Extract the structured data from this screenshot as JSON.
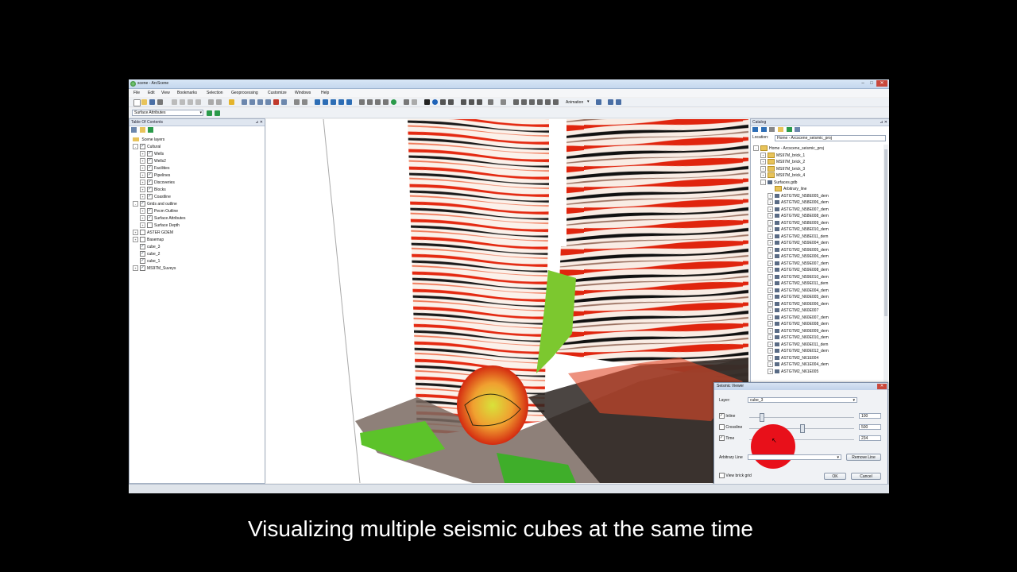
{
  "window": {
    "title": "scene - ArcScene"
  },
  "menu": [
    "File",
    "Edit",
    "View",
    "Bookmarks",
    "Selection",
    "Geoprocessing",
    "Customize",
    "Windows",
    "Help"
  ],
  "toolbar": {
    "animation_label": "Animation",
    "layer_dropdown": "Surface Attributes"
  },
  "toc": {
    "title": "Table Of Contents",
    "root": "Scene layers",
    "items": [
      {
        "label": "Cultural",
        "level": 1,
        "checked": true,
        "expand": "-"
      },
      {
        "label": "Wells",
        "level": 2,
        "checked": true,
        "expand": "+"
      },
      {
        "label": "Wells2",
        "level": 2,
        "checked": true,
        "expand": "+"
      },
      {
        "label": "Facilities",
        "level": 2,
        "checked": true,
        "expand": "+"
      },
      {
        "label": "Pipelines",
        "level": 2,
        "checked": true,
        "expand": "+"
      },
      {
        "label": "Discoveries",
        "level": 2,
        "checked": true,
        "expand": "+"
      },
      {
        "label": "Blocks",
        "level": 2,
        "checked": true,
        "expand": "+"
      },
      {
        "label": "Coastline",
        "level": 2,
        "checked": true,
        "expand": "+"
      },
      {
        "label": "Grids and outline",
        "level": 1,
        "checked": true,
        "expand": "-"
      },
      {
        "label": "Pecm Outline",
        "level": 2,
        "checked": true,
        "expand": "+"
      },
      {
        "label": "Surface Attributes",
        "level": 2,
        "checked": true,
        "expand": "+"
      },
      {
        "label": "Surface Depth",
        "level": 2,
        "checked": false,
        "expand": "+"
      },
      {
        "label": "ASTER GDEM",
        "level": 1,
        "checked": false,
        "expand": "+"
      },
      {
        "label": "Basemap",
        "level": 1,
        "checked": false,
        "expand": "+"
      },
      {
        "label": "cube_3",
        "level": 1,
        "checked": true,
        "expand": ""
      },
      {
        "label": "cube_2",
        "level": 1,
        "checked": true,
        "expand": ""
      },
      {
        "label": "cube_1",
        "level": 1,
        "checked": true,
        "expand": ""
      },
      {
        "label": "MS97M_Suveys",
        "level": 1,
        "checked": true,
        "expand": "+"
      }
    ]
  },
  "catalog": {
    "title": "Catalog",
    "location_label": "Location:",
    "location_value": "Home - Arcscene_seismic_proj",
    "root": "Home - Arcscene_seismic_proj",
    "folders": [
      "MS97M_brick_1",
      "MS97M_brick_2",
      "MS97M_brick_3",
      "MS97M_brick_4"
    ],
    "gdb": "Surfaces.gdb",
    "arbitrary": "Arbitrary_line",
    "rasters": [
      "ASTGTM2_N58E005_dem",
      "ASTGTM2_N58E006_dem",
      "ASTGTM2_N58E007_dem",
      "ASTGTM2_N58E008_dem",
      "ASTGTM2_N58E009_dem",
      "ASTGTM2_N58E010_dem",
      "ASTGTM2_N58E011_dem",
      "ASTGTM2_N59E004_dem",
      "ASTGTM2_N59E005_dem",
      "ASTGTM2_N59E006_dem",
      "ASTGTM2_N59E007_dem",
      "ASTGTM2_N59E008_dem",
      "ASTGTM2_N59E010_dem",
      "ASTGTM2_N59E011_dem",
      "ASTGTM2_N60E004_dem",
      "ASTGTM2_N60E005_dem",
      "ASTGTM2_N60E006_dem",
      "ASTGTM2_N60E007",
      "ASTGTM2_N60E007_dem",
      "ASTGTM2_N60E008_dem",
      "ASTGTM2_N60E009_dem",
      "ASTGTM2_N60E010_dem",
      "ASTGTM2_N60E011_dem",
      "ASTGTM2_N60E012_dem",
      "ASTGTM2_N61E004",
      "ASTGTM2_N61E004_dem",
      "ASTGTM2_N61E005"
    ]
  },
  "seismic_viewer": {
    "title": "Seismic Viewer",
    "layer_label": "Layer:",
    "layer_value": "cube_3",
    "inline_label": "Inline",
    "inline_value": "100",
    "inline_pos": 0.1,
    "crossline_label": "Crossline",
    "crossline_value": "500",
    "crossline_pos": 0.5,
    "time_label": "Time",
    "time_value": "234",
    "time_pos": 0.22,
    "arbitrary_label": "Arbitrary Line",
    "remove_line": "Remove Line",
    "brick_grid": "View brick grid",
    "ok": "OK",
    "cancel": "Cancel"
  },
  "caption": "Visualizing multiple seismic cubes at the same time"
}
